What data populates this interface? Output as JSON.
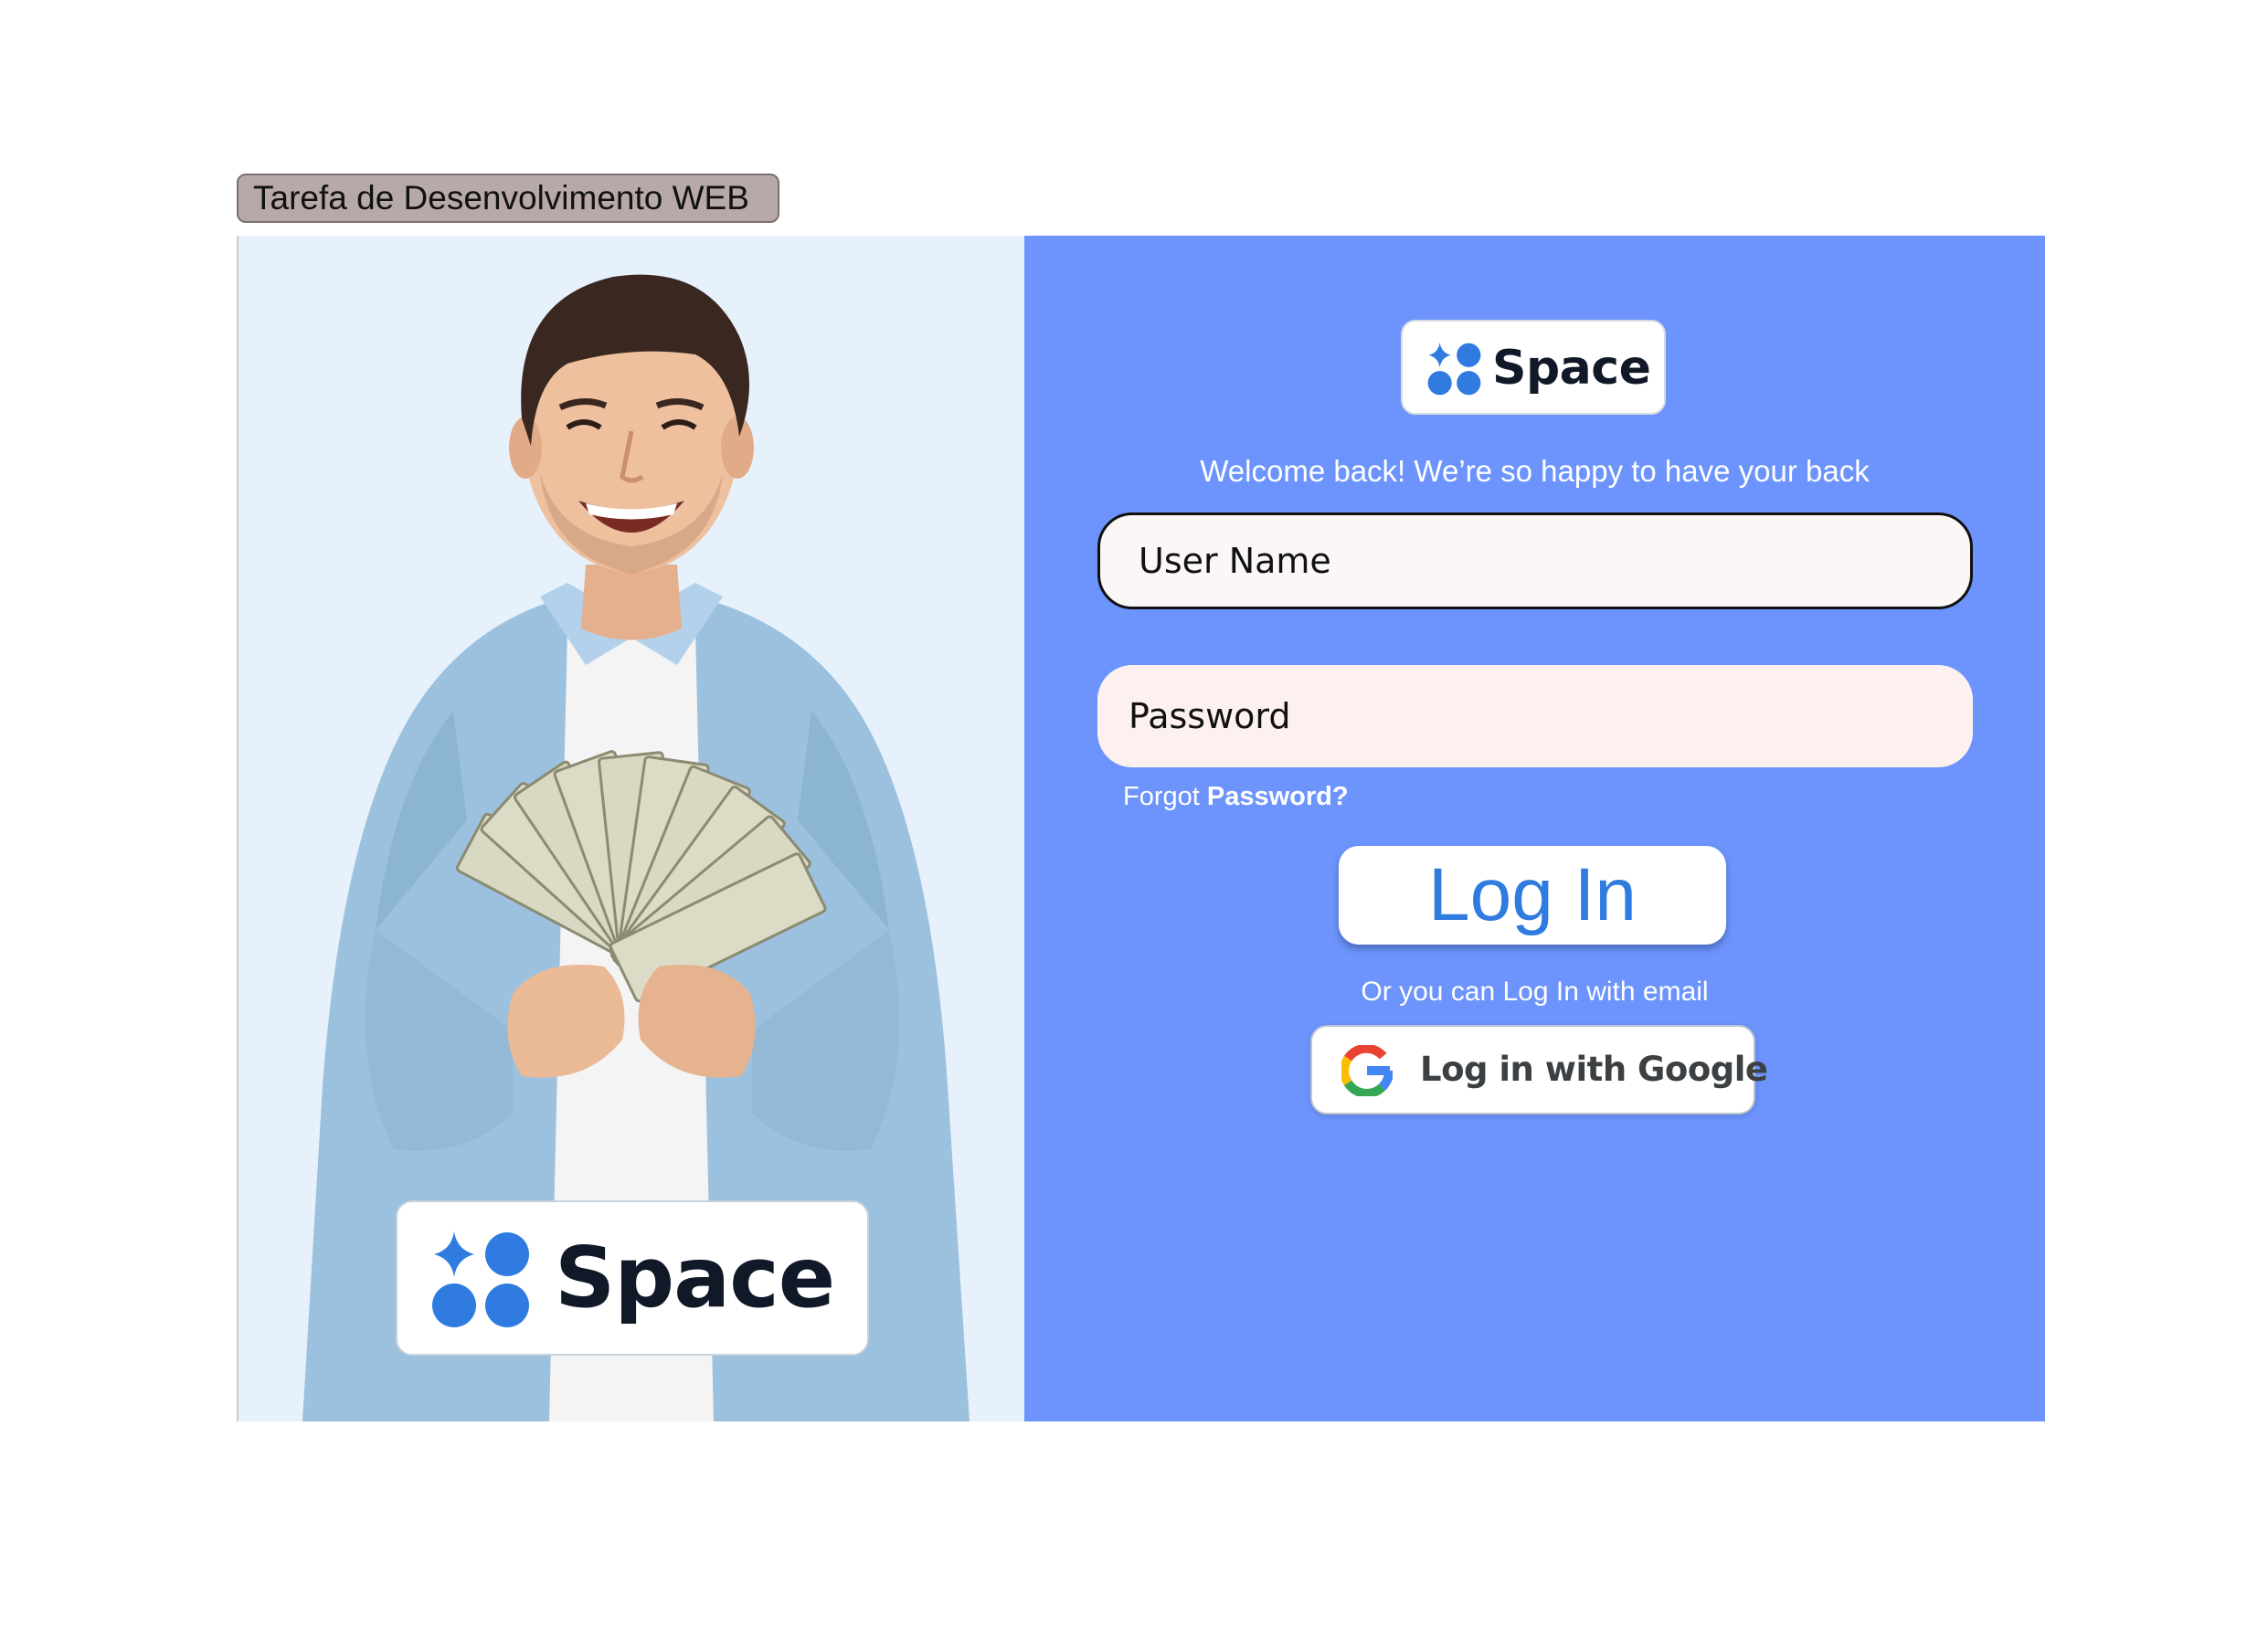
{
  "header": {
    "tag_label": "Tarefa de Desenvolvimento WEB"
  },
  "hero": {
    "brand_name": "Space",
    "illustration": "smiling-man-holding-dollar-bills"
  },
  "login": {
    "brand_name": "Space",
    "welcome_text": "Welcome back! We’re so happy to have your back",
    "username_placeholder": "User Name",
    "password_placeholder": "Password",
    "forgot_prefix": "Forgot",
    "forgot_emphasis": "Password?",
    "login_label": "Log In",
    "alt_text": "Or you can Log In with email",
    "google_label": "Log in with Google"
  },
  "icons": {
    "brand_mark": "space-logo-icon",
    "google": "google-icon"
  },
  "colors": {
    "panel_blue": "#6c94fc",
    "hero_background": "#e6f1fc",
    "tag_background": "#b7a9a7",
    "login_text": "#2f7be0",
    "brand_dots": "#2f7be0",
    "brand_text": "#111828"
  }
}
